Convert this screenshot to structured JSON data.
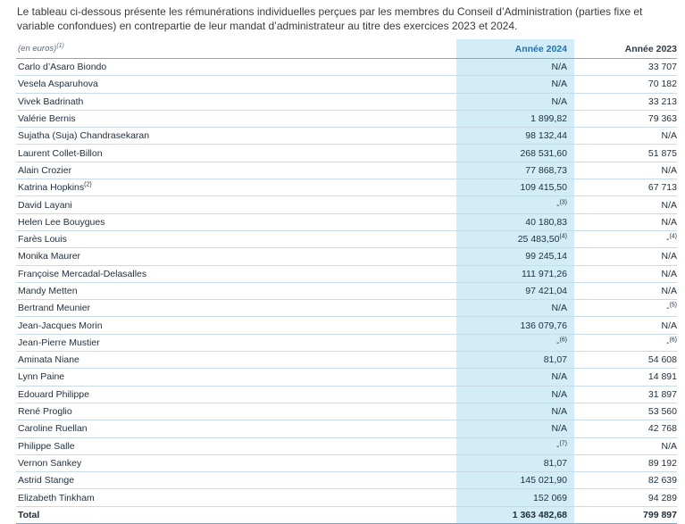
{
  "intro": "Le tableau ci-dessous présente les rémunérations individuelles perçues par les membres du Conseil d’Administration (parties fixe et variable confondues) en contrepartie de leur mandat d’administrateur au titre des exercices 2023 et 2024.",
  "table": {
    "unit_label": "(en euros)",
    "unit_note": "(1)",
    "col_2024": "Année 2024",
    "col_2023": "Année 2023",
    "rows": [
      {
        "name": "Carlo d’Asaro Biondo",
        "v2024": "N/A",
        "v2023": "33 707"
      },
      {
        "name": "Vesela Asparuhova",
        "v2024": "N/A",
        "v2023": "70 182"
      },
      {
        "name": "Vivek Badrinath",
        "v2024": "N/A",
        "v2023": "33 213"
      },
      {
        "name": "Valérie Bernis",
        "v2024": "1 899,82",
        "v2023": "79 363"
      },
      {
        "name": "Sujatha (Suja) Chandrasekaran",
        "v2024": "98 132,44",
        "v2023": "N/A"
      },
      {
        "name": "Laurent Collet-Billon",
        "v2024": "268 531,60",
        "v2023": "51 875"
      },
      {
        "name": "Alain Crozier",
        "v2024": "77 868,73",
        "v2023": "N/A"
      },
      {
        "name": "Katrina Hopkins",
        "name_note": "(2)",
        "v2024": "109 415,50",
        "v2023": "67 713"
      },
      {
        "name": "David Layani",
        "v2024": "-",
        "v2024_note": "(3)",
        "v2023": "N/A"
      },
      {
        "name": "Helen Lee Bouygues",
        "v2024": "40 180,83",
        "v2023": "N/A"
      },
      {
        "name": "Farès Louis",
        "v2024": "25 483,50",
        "v2024_note": "(4)",
        "v2023": "-",
        "v2023_note": "(4)"
      },
      {
        "name": "Monika Maurer",
        "v2024": "99 245,14",
        "v2023": "N/A"
      },
      {
        "name": "Françoise Mercadal-Delasalles",
        "v2024": "111 971,26",
        "v2023": "N/A"
      },
      {
        "name": "Mandy Metten",
        "v2024": "97 421,04",
        "v2023": "N/A"
      },
      {
        "name": "Bertrand Meunier",
        "v2024": "N/A",
        "v2023": "-",
        "v2023_note": "(5)"
      },
      {
        "name": "Jean-Jacques Morin",
        "v2024": "136 079,76",
        "v2023": "N/A"
      },
      {
        "name": "Jean-Pierre Mustier",
        "v2024": "-",
        "v2024_note": "(6)",
        "v2023": "-",
        "v2023_note": "(6)"
      },
      {
        "name": "Aminata Niane",
        "v2024": "81,07",
        "v2023": "54 608"
      },
      {
        "name": "Lynn Paine",
        "v2024": "N/A",
        "v2023": "14 891"
      },
      {
        "name": "Edouard Philippe",
        "v2024": "N/A",
        "v2023": "31 897"
      },
      {
        "name": "René Proglio",
        "v2024": "N/A",
        "v2023": "53 560"
      },
      {
        "name": "Caroline Ruellan",
        "v2024": "N/A",
        "v2023": "42 768"
      },
      {
        "name": "Philippe Salle",
        "v2024": "-",
        "v2024_note": "(7)",
        "v2023": "N/A"
      },
      {
        "name": "Vernon Sankey",
        "v2024": "81,07",
        "v2023": "89 192"
      },
      {
        "name": "Astrid Stange",
        "v2024": "145 021,90",
        "v2023": "82 639"
      },
      {
        "name": "Elizabeth Tinkham",
        "v2024": "152 069",
        "v2023": "94 289"
      }
    ],
    "total": {
      "name": "Total",
      "v2024": "1 363 482,68",
      "v2023": "799 897"
    }
  }
}
